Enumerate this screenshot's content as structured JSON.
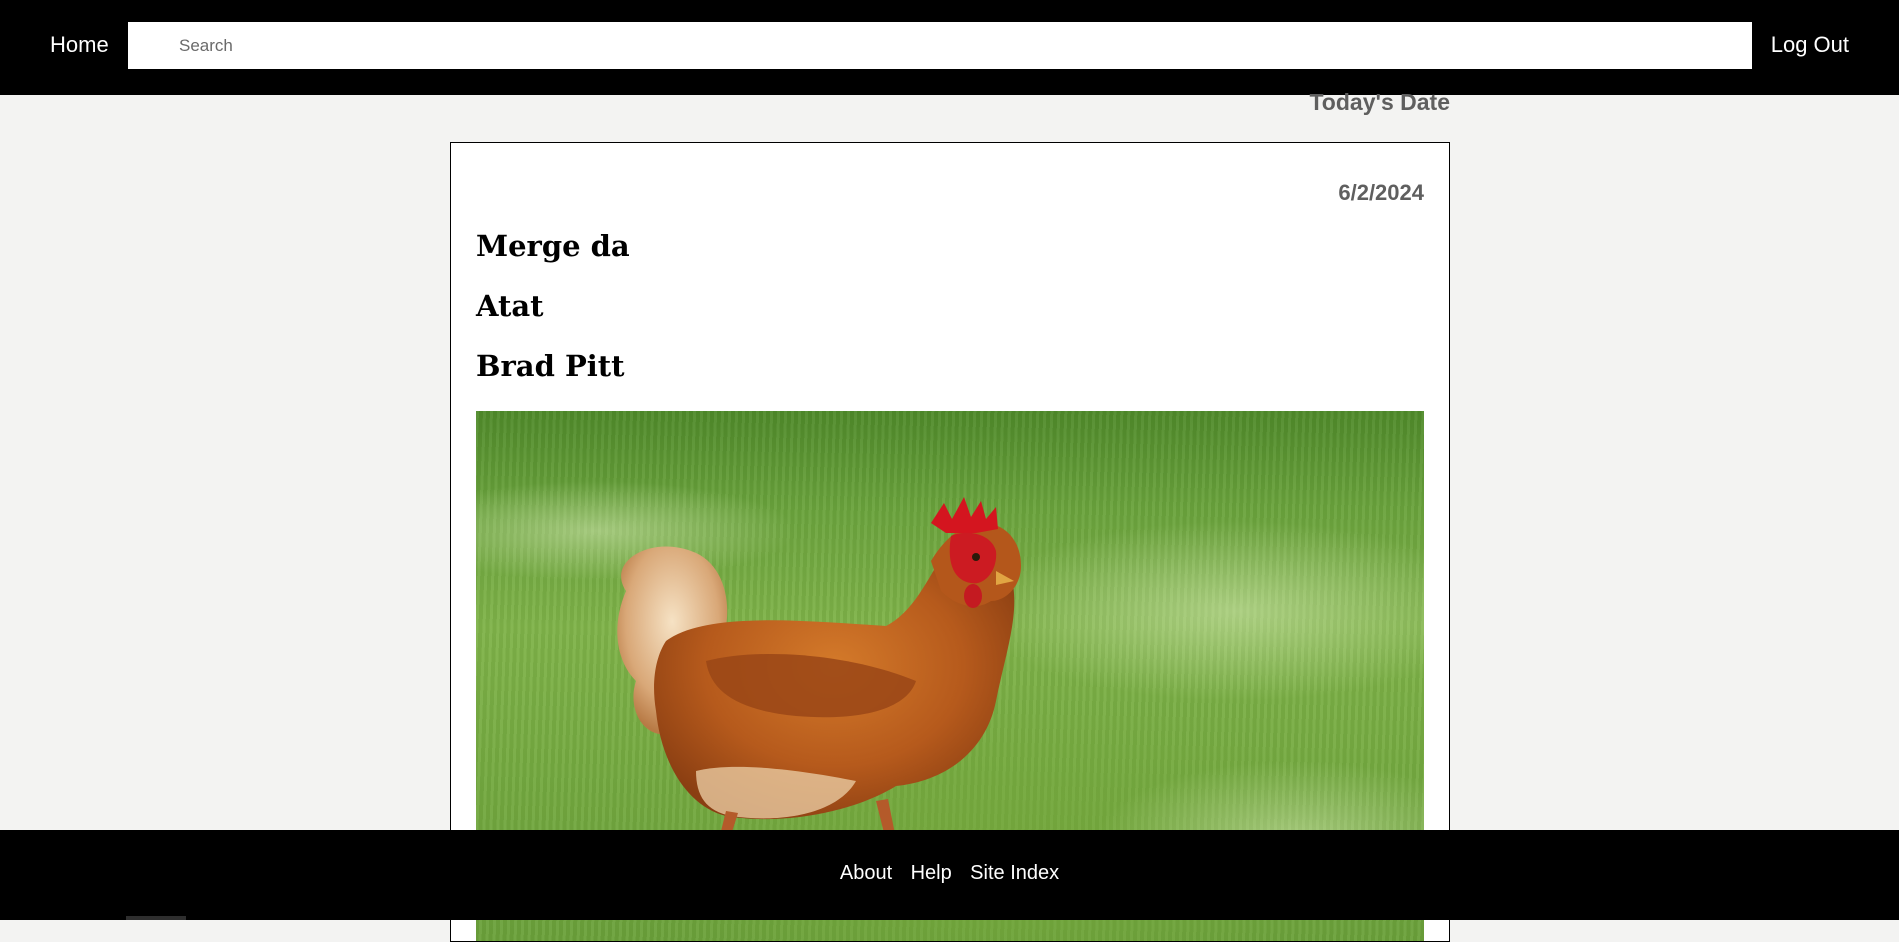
{
  "header": {
    "home_label": "Home",
    "search_placeholder": "Search",
    "logout_label": "Log Out"
  },
  "todays_date_label": "Today's Date",
  "card": {
    "date": "6/2/2024",
    "titles": [
      "Merge da",
      "Atat",
      "Brad Pitt"
    ],
    "image_alt": "chicken-photo"
  },
  "footer": {
    "links": [
      "About",
      "Help",
      "Site Index"
    ]
  },
  "colors": {
    "bar_bg": "#000000",
    "page_bg": "#f3f3f2",
    "date_text": "#5f5f5f"
  }
}
